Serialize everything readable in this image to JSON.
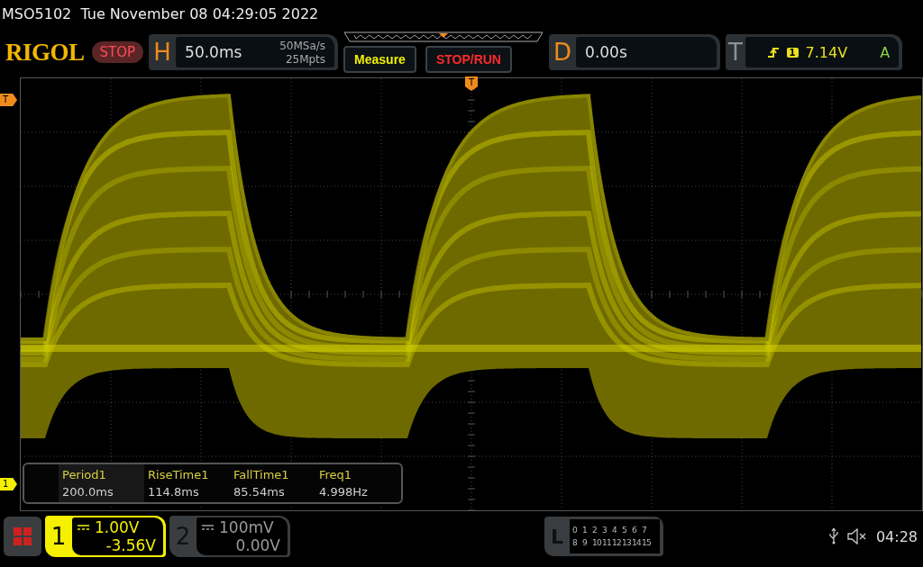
{
  "title": "MSO5102  Tue November 08 04:29:05 2022",
  "logo": "RIGOL",
  "run_status": "STOP",
  "horizontal": {
    "label": "H",
    "timebase": "50.0ms",
    "sample_rate": "50MSa/s",
    "memory_depth": "25Mpts"
  },
  "buttons": [
    {
      "label": "Measure",
      "kind": "measure"
    },
    {
      "label": "STOP/RUN",
      "kind": "stoprun"
    }
  ],
  "delay": {
    "label": "D",
    "value": "0.00s"
  },
  "trigger": {
    "label": "T",
    "source": "1",
    "level": "7.14V",
    "mode": "A"
  },
  "markers": {
    "trigger_position": "T",
    "trigger_level": "T",
    "channel": "1"
  },
  "measurements": [
    {
      "name": "Period1",
      "value": "200.0ms",
      "selected": true
    },
    {
      "name": "RiseTime1",
      "value": "114.8ms",
      "selected": false
    },
    {
      "name": "FallTime1",
      "value": "85.54ms",
      "selected": false
    },
    {
      "name": "Freq1",
      "value": "4.998Hz",
      "selected": false
    }
  ],
  "channels": [
    {
      "number": "1",
      "scale": "1.00V",
      "offset": "-3.56V",
      "selected": true
    },
    {
      "number": "2",
      "scale": "100mV",
      "offset": "0.00V",
      "selected": false
    }
  ],
  "logic": {
    "label": "L",
    "rows": [
      [
        "0",
        "1",
        "2",
        "3",
        "4",
        "5",
        "6",
        "7"
      ],
      [
        "8",
        "9",
        "10",
        "11",
        "12",
        "13",
        "14",
        "15"
      ]
    ]
  },
  "status": {
    "time": "04:28"
  }
}
